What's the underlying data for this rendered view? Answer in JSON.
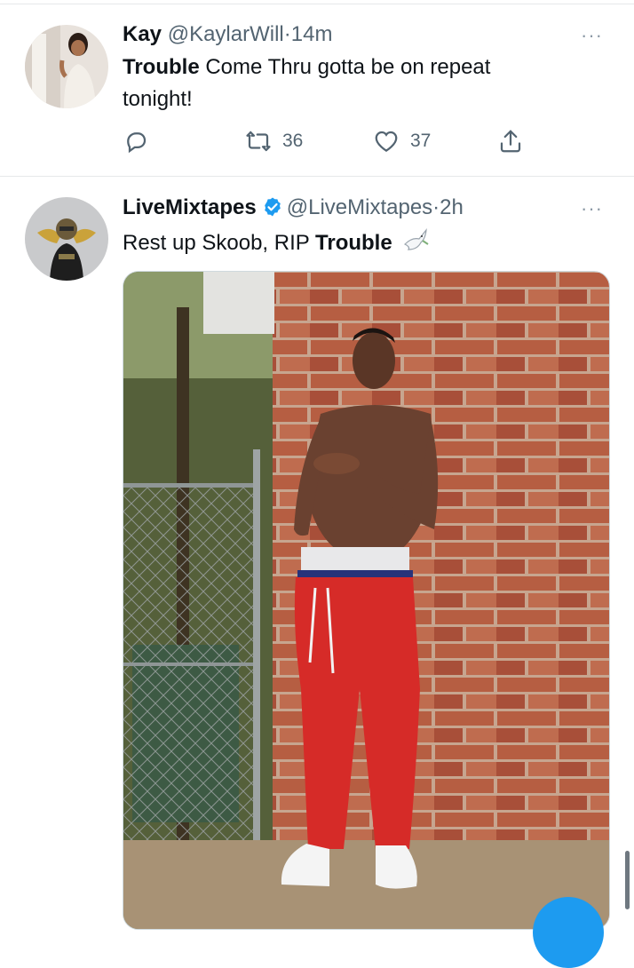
{
  "tweets": [
    {
      "display_name": "Kay",
      "handle": "@KaylarWill",
      "separator": "·",
      "time": "14m",
      "text_bold": "Trouble",
      "text_rest": " Come Thru gotta be on repeat",
      "text_line2": "tonight!",
      "retweets": "36",
      "likes": "37",
      "more": "···"
    },
    {
      "display_name": "LiveMixtapes",
      "handle": "@LiveMixtapes",
      "separator": "·",
      "time": "2h",
      "text_plain": "Rest up Skoob, RIP ",
      "text_bold": "Trouble",
      "emoji": "🕊",
      "more": "···",
      "verified": true
    }
  ],
  "colors": {
    "accent": "#1d9bf0",
    "text_secondary": "#536471",
    "divider": "#e6e8ea"
  },
  "icons": [
    "reply-icon",
    "retweet-icon",
    "like-icon",
    "share-icon",
    "more-icon",
    "verified-badge-icon",
    "dove-icon"
  ]
}
